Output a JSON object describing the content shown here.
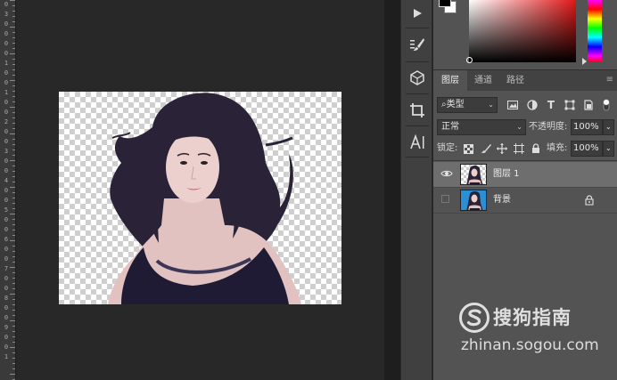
{
  "ruler": {
    "labels": [
      "0",
      "3",
      "0",
      "0",
      "0",
      "0",
      "1",
      "0",
      "0",
      "1",
      "0",
      "0",
      "2",
      "0",
      "0",
      "3",
      "0",
      "0",
      "4",
      "0",
      "0",
      "5",
      "0",
      "0",
      "6",
      "0",
      "0",
      "7",
      "0",
      "0",
      "8",
      "0",
      "0",
      "9",
      "0",
      "0",
      "1"
    ]
  },
  "tabs": {
    "layers": "图层",
    "channels": "通道",
    "paths": "路径"
  },
  "filter": {
    "kind_label": "⌕类型"
  },
  "blend": {
    "mode": "正常",
    "opacity_label": "不透明度:",
    "opacity_value": "100%"
  },
  "lock": {
    "label": "锁定:",
    "fill_label": "填充:",
    "fill_value": "100%"
  },
  "layers": [
    {
      "name": "图层 1",
      "visible": true,
      "selected": true,
      "locked": false
    },
    {
      "name": "背景",
      "visible": false,
      "selected": false,
      "locked": true
    }
  ],
  "colors": {
    "foreground": "#000000",
    "background": "#ffffff",
    "picker_hue": "#e01818"
  },
  "tools": [
    "play-icon",
    "brush-preset-icon",
    "3d-icon",
    "crop-icon",
    "character-icon"
  ],
  "watermark": {
    "brand": "搜狗指南",
    "url": "zhinan.sogou.com"
  }
}
